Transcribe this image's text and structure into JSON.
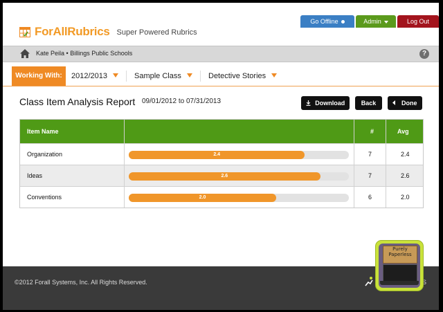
{
  "header": {
    "app_name": "ForAllRubrics",
    "tagline": "Super Powered Rubrics",
    "buttons": {
      "go_offline": "Go Offline",
      "admin": "Admin",
      "log_out": "Log Out"
    }
  },
  "userbar": {
    "user_name": "Kate Peila",
    "separator": "•",
    "school": "Billings Public Schools",
    "help": "?"
  },
  "working_with": {
    "label": "Working With:",
    "year": "2012/2013",
    "class": "Sample Class",
    "rubric": "Detective Stories"
  },
  "report": {
    "title": "Class Item Analysis Report",
    "date_start": "09/01/2012",
    "date_joiner": "to",
    "date_end": "07/31/2013",
    "download_label": "Download",
    "back_label": "Back",
    "done_label": "Done"
  },
  "table": {
    "headers": {
      "item_name": "Item Name",
      "count": "#",
      "avg": "Avg"
    },
    "rows": [
      {
        "name": "Organization",
        "bar_label": "2.4",
        "count": "7",
        "avg": "2.4",
        "bar_fraction": 0.8
      },
      {
        "name": "Ideas",
        "bar_label": "2.6",
        "count": "7",
        "avg": "2.6",
        "bar_fraction": 0.87
      },
      {
        "name": "Conventions",
        "bar_label": "2.0",
        "count": "6",
        "avg": "2.0",
        "bar_fraction": 0.67
      }
    ]
  },
  "footer": {
    "copyright": "©2012 Forall Systems, Inc. All Rights Reserved.",
    "partial_text": "S"
  },
  "badge": {
    "line1": "Purely",
    "line2": "Paperless"
  },
  "colors": {
    "brand_orange": "#ef8a24",
    "table_header_green": "#4f9a16",
    "offline_blue": "#3b7fc4",
    "admin_green": "#5b9a1c",
    "logout_red": "#a3141d"
  }
}
